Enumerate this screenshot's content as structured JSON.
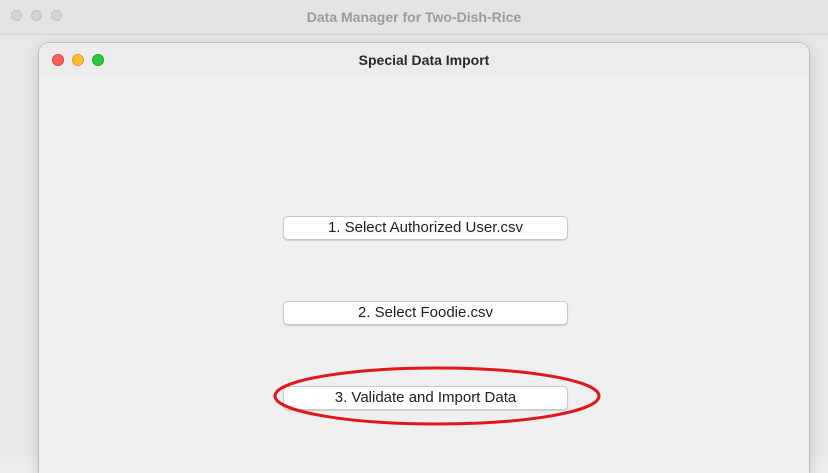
{
  "back_window": {
    "title": "Data Manager for Two-Dish-Rice"
  },
  "dialog": {
    "title": "Special Data Import",
    "buttons": {
      "select_authorized_user": "1. Select Authorized User.csv",
      "select_foodie": "2. Select Foodie.csv",
      "validate_import": "3. Validate and Import Data"
    }
  },
  "annotation": {
    "highlight_color": "#e0171a"
  },
  "colors": {
    "close": "#fe5f57",
    "minimize": "#febc2e",
    "maximize": "#28c840"
  }
}
